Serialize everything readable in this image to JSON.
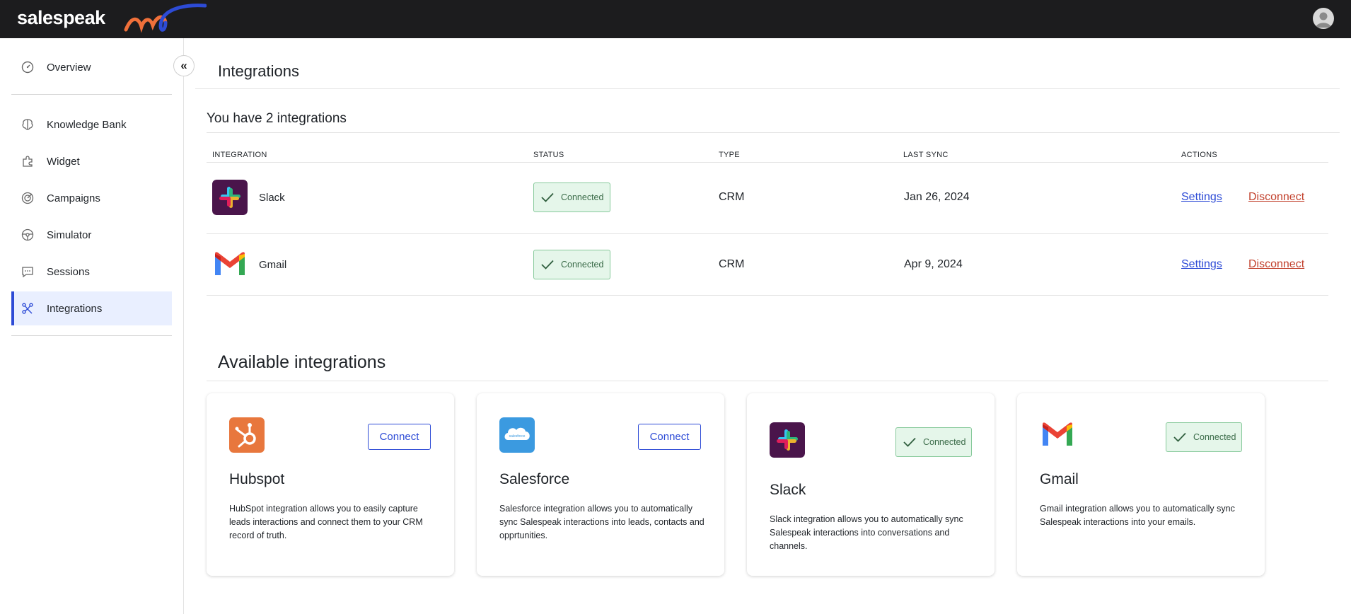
{
  "brand": {
    "logo_text": "salespeak"
  },
  "sidebar": {
    "items": [
      {
        "label": "Overview",
        "icon": "dashboard-icon"
      },
      {
        "label": "Knowledge Bank",
        "icon": "brain-icon"
      },
      {
        "label": "Widget",
        "icon": "puzzle-icon"
      },
      {
        "label": "Campaigns",
        "icon": "target-icon"
      },
      {
        "label": "Simulator",
        "icon": "steering-wheel-icon"
      },
      {
        "label": "Sessions",
        "icon": "chat-bubble-icon"
      },
      {
        "label": "Integrations",
        "icon": "integrations-icon",
        "active": true
      }
    ],
    "collapse_glyph": "«"
  },
  "main": {
    "title": "Integrations",
    "count_title": "You have 2 integrations",
    "table": {
      "headers": [
        "INTEGRATION",
        "STATUS",
        "TYPE",
        "LAST SYNC",
        "ACTIONS"
      ],
      "rows": [
        {
          "name": "Slack",
          "status": "Connected",
          "type": "CRM",
          "last_sync": "Jan 26, 2024",
          "settings": "Settings",
          "disconnect": "Disconnect"
        },
        {
          "name": "Gmail",
          "status": "Connected",
          "type": "CRM",
          "last_sync": "Apr 9, 2024",
          "settings": "Settings",
          "disconnect": "Disconnect"
        }
      ]
    },
    "available": {
      "title": "Available integrations",
      "cards": [
        {
          "name": "Hubspot",
          "action": "Connect",
          "description": "HubSpot integration allows you to easily capture leads interactions and connect them to your CRM record of truth."
        },
        {
          "name": "Salesforce",
          "action": "Connect",
          "logo_text": "salesforce",
          "description": "Salesforce integration allows you to automatically sync Salespeak interactions into leads, contacts and opprtunities."
        },
        {
          "name": "Slack",
          "status": "Connected",
          "description": "Slack integration allows you to automatically sync Salespeak interactions into conversations and channels."
        },
        {
          "name": "Gmail",
          "status": "Connected",
          "description": "Gmail integration allows you to automatically sync Salespeak interactions into your emails."
        }
      ]
    }
  },
  "colors": {
    "accent": "#2d4bd6",
    "danger": "#c2412d",
    "success_bg": "#e5f6ea",
    "success_border": "#86c99a",
    "topbar": "#1c1c1e"
  }
}
